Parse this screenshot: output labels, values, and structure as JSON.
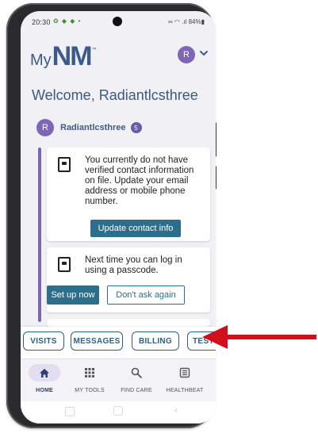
{
  "status_bar": {
    "time": "20:30",
    "left_icons": "✿ ◆ ◆ •",
    "right_icons": "∞ ◠ .ıl 84%▮"
  },
  "header": {
    "logo_prefix": "My",
    "logo_main": "NM",
    "logo_tm": "™",
    "avatar_initial": "R",
    "accent_color": "#3d5a89",
    "avatar_color": "#7d66b6"
  },
  "welcome": {
    "text": "Welcome, Radiantlcsthree"
  },
  "account": {
    "avatar_initial": "R",
    "name": "Radiantlcsthree",
    "badge_count": "5"
  },
  "cards": {
    "contact": {
      "text": "You currently do not have verified contact information on file. Update your email address or mobile phone number.",
      "button": "Update contact info"
    },
    "passcode": {
      "text": "Next time you can log in using a passcode.",
      "primary_button": "Set up now",
      "secondary_button": "Don't ask again"
    }
  },
  "quick_links": [
    "VISITS",
    "MESSAGES",
    "BILLING",
    "TEST"
  ],
  "bottom_nav": {
    "items": [
      {
        "label": "HOME",
        "icon": "home-icon",
        "active": true
      },
      {
        "label": "MY TOOLS",
        "icon": "grid-icon",
        "active": false
      },
      {
        "label": "FIND CARE",
        "icon": "search-icon",
        "active": false
      },
      {
        "label": "HEALTHBEAT",
        "icon": "news-icon",
        "active": false
      }
    ]
  },
  "annotation": {
    "arrow_color": "#d0111b"
  }
}
